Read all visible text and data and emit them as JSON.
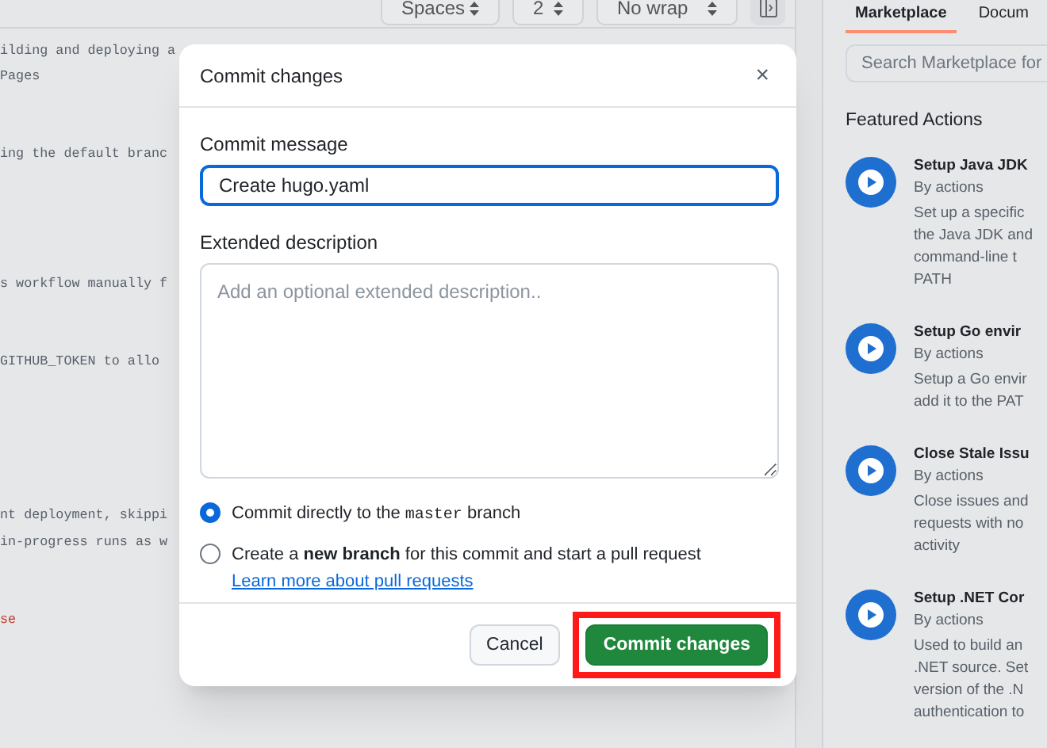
{
  "toolbar": {
    "selects": [
      {
        "label": "Spaces"
      },
      {
        "label": "2"
      },
      {
        "label": "No wrap"
      }
    ]
  },
  "editor": {
    "lines": [
      {
        "kind": "text",
        "text": "ilding and deploying a"
      },
      {
        "kind": "text",
        "text": "Pages"
      },
      {
        "kind": "blank"
      },
      {
        "kind": "blank"
      },
      {
        "kind": "text",
        "text": "ing the default branc"
      },
      {
        "kind": "blank"
      },
      {
        "kind": "blank"
      },
      {
        "kind": "blank"
      },
      {
        "kind": "blank"
      },
      {
        "kind": "text",
        "text": "s workflow manually f"
      },
      {
        "kind": "blank"
      },
      {
        "kind": "blank"
      },
      {
        "kind": "text",
        "text": "GITHUB_TOKEN to allo"
      },
      {
        "kind": "blank"
      },
      {
        "kind": "blank"
      },
      {
        "kind": "blank"
      },
      {
        "kind": "blank"
      },
      {
        "kind": "blank"
      },
      {
        "kind": "text",
        "text": "nt deployment, skippi"
      },
      {
        "kind": "text",
        "text": "in-progress runs as w"
      },
      {
        "kind": "blank"
      },
      {
        "kind": "blank"
      },
      {
        "kind": "string",
        "text": "se"
      }
    ]
  },
  "dialog": {
    "title": "Commit changes",
    "close": "×",
    "message_label": "Commit message",
    "message_value": "Create hugo.yaml",
    "description_label": "Extended description",
    "description_placeholder": "Add an optional extended description..",
    "options": [
      {
        "selected": true,
        "text": "Commit directly to the ",
        "code": "master",
        "text_after": " branch"
      },
      {
        "selected": false,
        "text": "Create a **new branch** for this commit and start a pull request ",
        "link": "Learn more about pull requests"
      }
    ],
    "buttons": [
      {
        "kind": "secondary",
        "label": "Cancel",
        "highlighted": false
      },
      {
        "kind": "primary",
        "label": "Commit changes",
        "highlighted": true
      }
    ]
  },
  "marketplace": {
    "tabs": [
      {
        "label": "Marketplace",
        "selected": true
      },
      {
        "label": "Docum",
        "selected": false
      }
    ],
    "search": {
      "placeholder": "Search Marketplace for"
    },
    "heading": "Featured Actions",
    "actions": [
      {
        "title": "Setup Java JDK",
        "author": "By actions",
        "description_lines": [
          "Set up a specific",
          "the Java JDK and",
          "command-line t",
          "PATH"
        ]
      },
      {
        "title": "Setup Go envir",
        "author": "By actions",
        "description_lines": [
          "Setup a Go envir",
          "add it to the PAT"
        ]
      },
      {
        "title": "Close Stale Issu",
        "author": "By actions",
        "description_lines": [
          "Close issues and",
          "requests with no",
          "activity"
        ]
      },
      {
        "title": "Setup .NET Cor",
        "author": "By actions",
        "description_lines": [
          "Used to build an",
          ".NET source. Set",
          "version of the .N",
          "authentication to"
        ]
      }
    ]
  }
}
